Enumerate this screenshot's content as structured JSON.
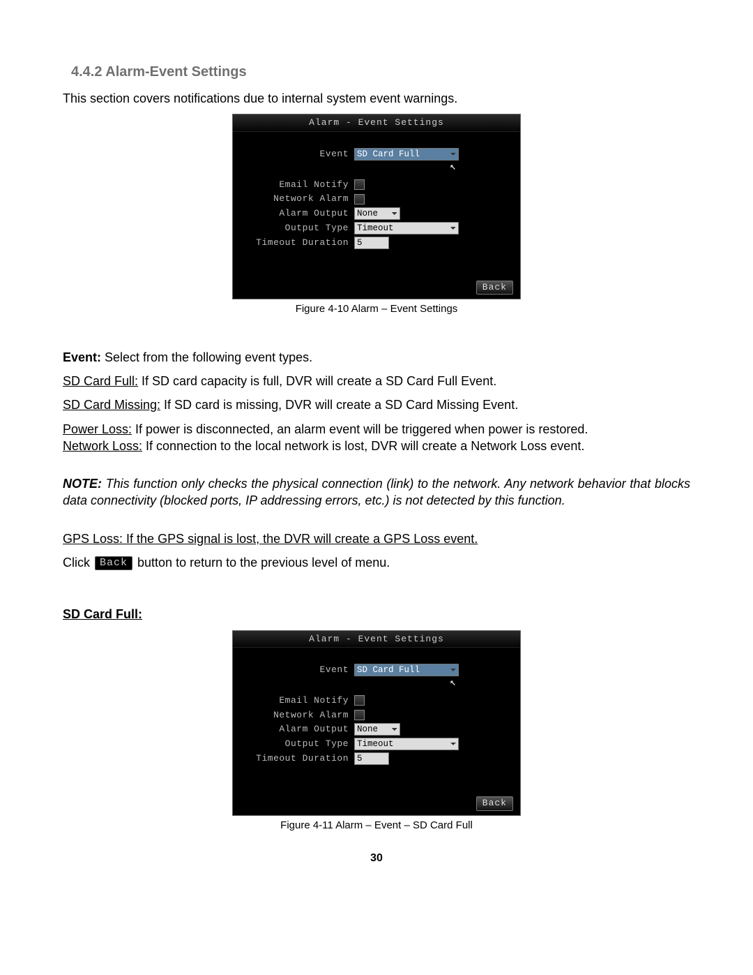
{
  "section": {
    "number_title": "4.4.2 Alarm-Event Settings",
    "intro": "This section covers notifications due to internal system event warnings."
  },
  "dvr1": {
    "title": "Alarm - Event Settings",
    "rows": {
      "event_label": "Event",
      "event_value": "SD Card Full",
      "email_notify_label": "Email Notify",
      "network_alarm_label": "Network Alarm",
      "alarm_output_label": "Alarm Output",
      "alarm_output_value": "None",
      "output_type_label": "Output Type",
      "output_type_value": "Timeout",
      "timeout_duration_label": "Timeout Duration",
      "timeout_duration_value": "5"
    },
    "back": "Back"
  },
  "fig1_caption": "Figure 4-10 Alarm – Event Settings",
  "body": {
    "event_lead_bold": "Event:",
    "event_lead_rest": " Select from the following event types.",
    "sd_full_u": "SD Card Full:",
    "sd_full_rest": " If SD card capacity is full, DVR will create a SD Card Full Event.",
    "sd_missing_u": "SD Card Missing:",
    "sd_missing_rest": " If SD card is missing, DVR will create a SD Card Missing Event.",
    "power_loss_u": "Power Loss:",
    "power_loss_rest": " If power is disconnected, an alarm event will be triggered when power is restored.",
    "network_loss_u": "Network Loss:",
    "network_loss_rest": " If connection to the local network is lost, DVR will create a Network Loss event.",
    "note_bold": "NOTE:",
    "note_rest": " This function only checks the physical connection (link) to the network. Any network behavior that blocks data connectivity (blocked ports, IP addressing errors, etc.) is not detected by this function.",
    "gps_u": "GPS Loss: If the GPS signal is lost, the DVR will create a GPS Loss event.",
    "click_pre": "Click ",
    "back_inline": "Back",
    "click_post": " button to return to the previous level of menu."
  },
  "sd_card_full_heading": "SD Card Full:",
  "dvr2": {
    "title": "Alarm - Event Settings",
    "rows": {
      "event_label": "Event",
      "event_value": "SD Card Full",
      "email_notify_label": "Email Notify",
      "network_alarm_label": "Network Alarm",
      "alarm_output_label": "Alarm Output",
      "alarm_output_value": "None",
      "output_type_label": "Output Type",
      "output_type_value": "Timeout",
      "timeout_duration_label": "Timeout Duration",
      "timeout_duration_value": "5"
    },
    "back": "Back"
  },
  "fig2_caption": "Figure 4-11 Alarm – Event – SD Card Full",
  "page_number": "30"
}
